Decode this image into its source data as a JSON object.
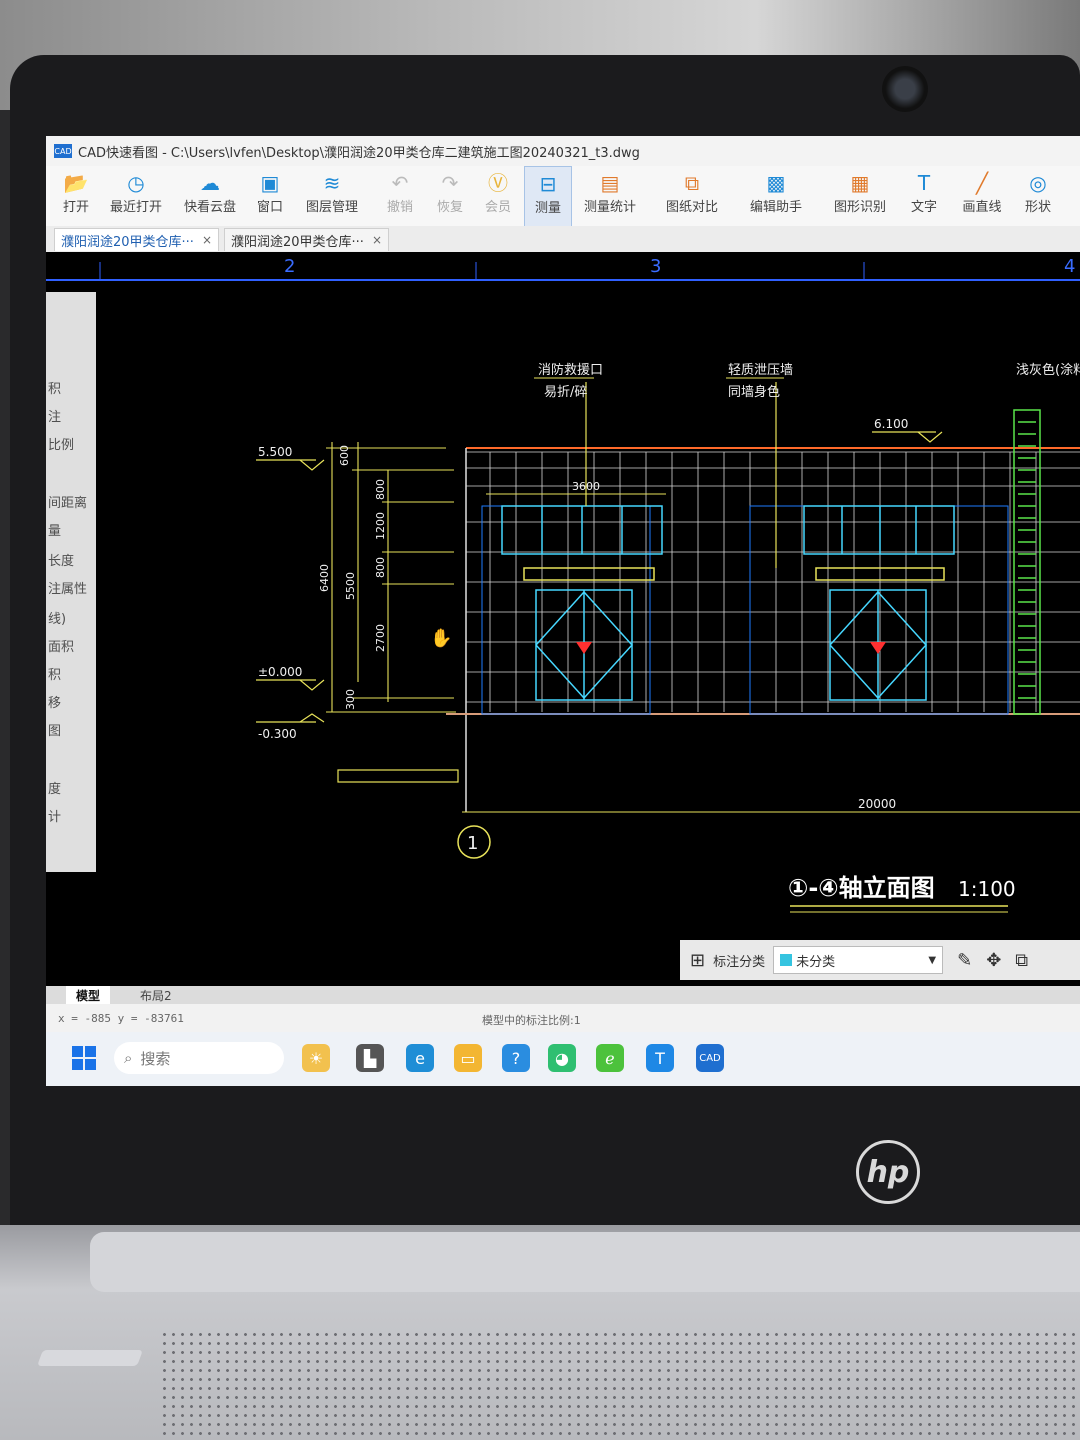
{
  "window": {
    "title": "CAD快速看图 - C:\\Users\\lvfen\\Desktop\\濮阳润途20甲类仓库二建筑施工图20240321_t3.dwg",
    "app_icon": "CAD"
  },
  "toolbar": {
    "items": [
      {
        "label": "打开",
        "icon": "folder-icon"
      },
      {
        "label": "最近打开",
        "icon": "clock-icon"
      },
      {
        "label": "快看云盘",
        "icon": "cloud-icon"
      },
      {
        "label": "窗口",
        "icon": "window-icon"
      },
      {
        "label": "图层管理",
        "icon": "layers-icon"
      },
      {
        "label": "撤销",
        "icon": "undo-icon"
      },
      {
        "label": "恢复",
        "icon": "redo-icon"
      },
      {
        "label": "会员",
        "icon": "vip-icon"
      },
      {
        "label": "测量",
        "icon": "ruler-icon"
      },
      {
        "label": "测量统计",
        "icon": "stats-icon"
      },
      {
        "label": "图纸对比",
        "icon": "compare-icon"
      },
      {
        "label": "编辑助手",
        "icon": "cad-edit-icon"
      },
      {
        "label": "图形识别",
        "icon": "shape-recognize-icon"
      },
      {
        "label": "文字",
        "icon": "text-icon"
      },
      {
        "label": "画直线",
        "icon": "line-icon"
      },
      {
        "label": "形状",
        "icon": "shape-icon"
      }
    ]
  },
  "tabs": [
    {
      "label": "濮阳润途20甲类仓库···",
      "close": "×"
    },
    {
      "label": "濮阳润途20甲类仓库···",
      "close": "×"
    }
  ],
  "side_panel": {
    "items": [
      "积",
      "注",
      "比例",
      "间距离",
      "量",
      "长度",
      "注属性",
      "线)",
      "面积",
      "积",
      "移",
      "图",
      "度",
      "计"
    ]
  },
  "drawing": {
    "axis_numbers": [
      "2",
      "3",
      "4"
    ],
    "notes": [
      "消防救援口",
      "易折/碎",
      "轻质泄压墙",
      "同墙身色",
      "浅灰色(涂料"
    ],
    "elevations": [
      "5.500",
      "6.100",
      "±0.000",
      "-0.300"
    ],
    "dimensions": [
      "600",
      "800",
      "1200",
      "800",
      "2700",
      "300",
      "6400",
      "5500",
      "3600",
      "20000"
    ],
    "grid_bubble": "1",
    "elevation_title": "①-④轴立面图",
    "scale": "1:100"
  },
  "annotation_toolbar": {
    "label": "标注分类",
    "selected": "未分类",
    "swatch_color": "#35c4e0"
  },
  "layout_tabs": [
    "模型",
    "布局2"
  ],
  "status": {
    "coords": "x = -885  y = -83761",
    "scale_text": "模型中的标注比例:1"
  },
  "taskbar": {
    "search_placeholder": "搜索",
    "cad_app": "CAD"
  },
  "hardware": {
    "logo": "hp"
  }
}
